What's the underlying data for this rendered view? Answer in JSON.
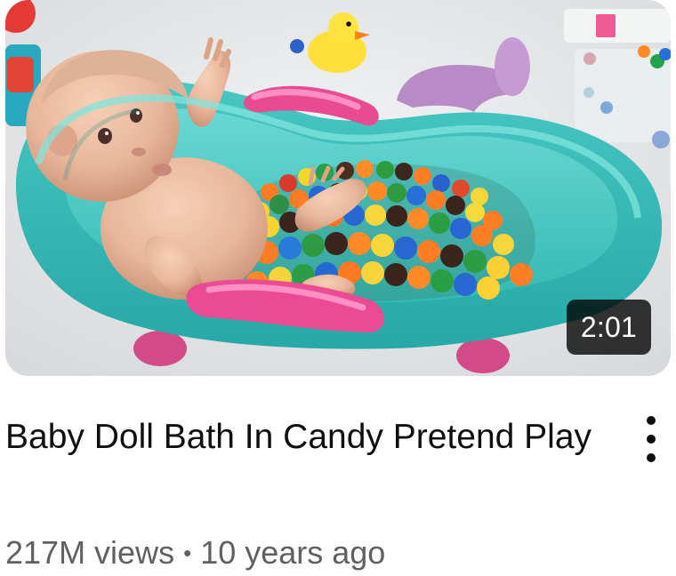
{
  "video": {
    "duration": "2:01",
    "title": "Baby Doll Bath In Candy Pretend Play",
    "views": "217M views",
    "separator": "•",
    "age": "10 years ago"
  },
  "icons": {
    "more_actions": "vertical-ellipsis-icon"
  }
}
